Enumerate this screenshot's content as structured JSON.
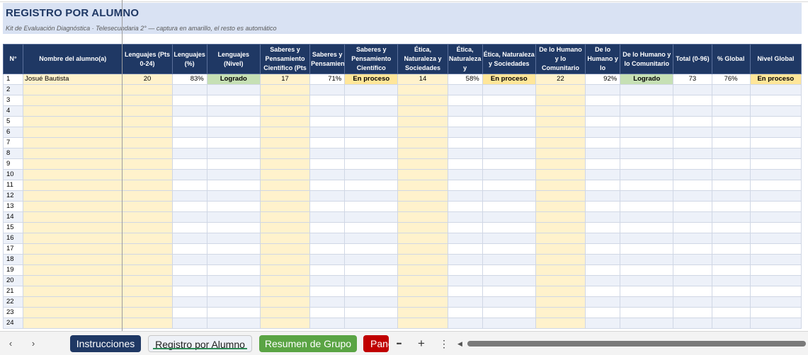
{
  "banner": {
    "title": "REGISTRO POR ALUMNO",
    "subtitle": "Kit de Evaluación Diagnóstica · Telesecundaria 2° — captura en amarillo, el resto es automático"
  },
  "columns": [
    "N°",
    "Nombre del alumno(a)",
    "Lenguajes (Pts 0-24)",
    "Lenguajes (%)",
    "Lenguajes (Nivel)",
    "Saberes y Pensamiento Científico (Pts",
    "Saberes y Pensamiento",
    "Saberes y Pensamiento Científico",
    "Ética, Naturaleza y Sociedades",
    "Ética, Naturaleza y",
    "Ética, Naturaleza y Sociedades",
    "De lo Humano y lo Comunitario",
    "De lo Humano y lo",
    "De lo Humano y lo Comunitario",
    "Total (0-96)",
    "% Global",
    "Nivel Global"
  ],
  "rows": [
    {
      "n": "1",
      "name": "Josué Bautista",
      "len_pts": "20",
      "len_pct": "83%",
      "len_lvl": "Logrado",
      "sab_pts": "17",
      "sab_pct": "71%",
      "sab_lvl": "En proceso",
      "eti_pts": "14",
      "eti_pct": "58%",
      "eti_lvl": "En proceso",
      "hum_pts": "22",
      "hum_pct": "92%",
      "hum_lvl": "Logrado",
      "total": "73",
      "pct_global": "76%",
      "lvl_global": "En proceso"
    },
    {
      "n": "2"
    },
    {
      "n": "3"
    },
    {
      "n": "4"
    },
    {
      "n": "5"
    },
    {
      "n": "6"
    },
    {
      "n": "7"
    },
    {
      "n": "8"
    },
    {
      "n": "9"
    },
    {
      "n": "10"
    },
    {
      "n": "11"
    },
    {
      "n": "12"
    },
    {
      "n": "13"
    },
    {
      "n": "14"
    },
    {
      "n": "15"
    },
    {
      "n": "16"
    },
    {
      "n": "17"
    },
    {
      "n": "18"
    },
    {
      "n": "19"
    },
    {
      "n": "20"
    },
    {
      "n": "21"
    },
    {
      "n": "22"
    },
    {
      "n": "23"
    },
    {
      "n": "24"
    }
  ],
  "tabs": {
    "nav_prev_icon": "‹",
    "nav_next_icon": "›",
    "instrucciones": "Instrucciones",
    "registro": "Registro por Alumno",
    "resumen": "Resumen de Grupo",
    "panel": "Panel",
    "more_icon": "•••",
    "add_icon": "+",
    "menu_icon": "⋮"
  },
  "colors": {
    "header_bg": "#1f3864",
    "banner_bg": "#d9e2f3",
    "capture_yellow": "#fff2cc",
    "level_logrado": "#c6e0b4",
    "level_proceso": "#ffe699",
    "tab_instrucciones": "#1f3864",
    "tab_resumen": "#5aa444",
    "tab_panel": "#c00000"
  }
}
